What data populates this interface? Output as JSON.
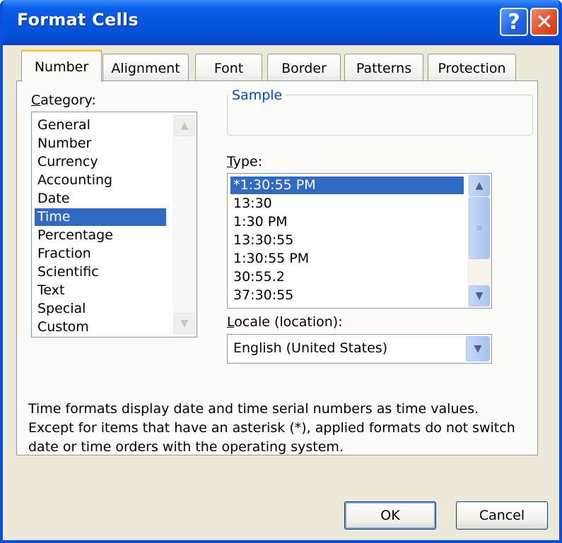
{
  "window": {
    "title": "Format Cells",
    "help_symbol": "?",
    "close_symbol": "✕"
  },
  "tabs": [
    {
      "label": "Number",
      "active": true
    },
    {
      "label": "Alignment",
      "active": false
    },
    {
      "label": "Font",
      "active": false
    },
    {
      "label": "Border",
      "active": false
    },
    {
      "label": "Patterns",
      "active": false
    },
    {
      "label": "Protection",
      "active": false
    }
  ],
  "category": {
    "label_mnemonic": "C",
    "label_rest": "ategory:",
    "items": [
      "General",
      "Number",
      "Currency",
      "Accounting",
      "Date",
      "Time",
      "Percentage",
      "Fraction",
      "Scientific",
      "Text",
      "Special",
      "Custom"
    ],
    "selected": "Time"
  },
  "sample": {
    "label": "Sample",
    "value": ""
  },
  "type": {
    "label_mnemonic": "T",
    "label_rest": "ype:",
    "items": [
      "*1:30:55 PM",
      "13:30",
      "1:30 PM",
      "13:30:55",
      "1:30:55 PM",
      "30:55.2",
      "37:30:55"
    ],
    "selected": "*1:30:55 PM"
  },
  "locale": {
    "label_mnemonic": "L",
    "label_rest": "ocale (location):",
    "value": "English (United States)"
  },
  "description": "Time formats display date and time serial numbers as time values. Except for items that have an asterisk (*), applied formats do not switch date or time orders with the operating system.",
  "buttons": {
    "ok": "OK",
    "cancel": "Cancel"
  },
  "icons": {
    "scroll_up": "up-arrow-icon",
    "scroll_down": "down-arrow-icon",
    "dropdown": "chevron-down-icon"
  },
  "colors": {
    "titlebar": "#0656e0",
    "selection": "#316ac5",
    "active_tab_accent": "#ffc83c",
    "sample_label": "#0046d5"
  }
}
